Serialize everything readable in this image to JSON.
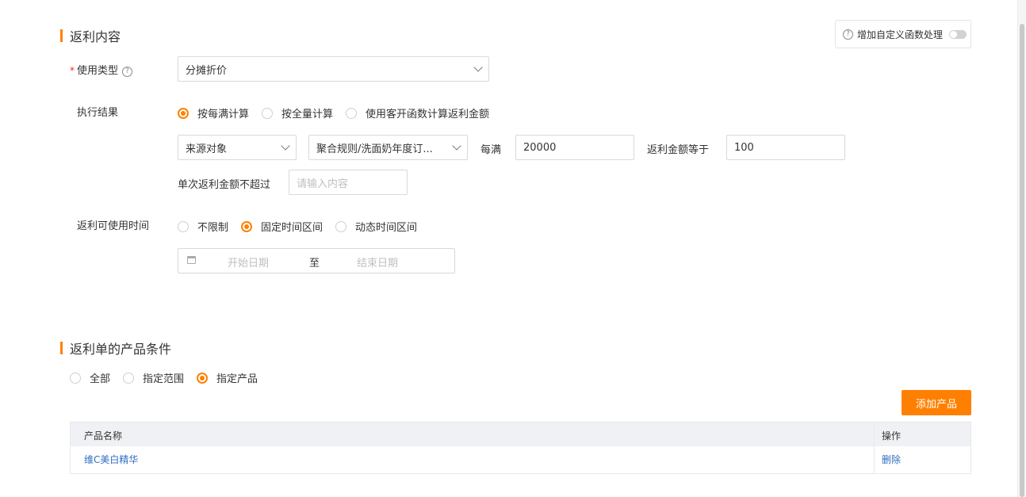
{
  "rebate_content": {
    "title": "返利内容",
    "custom_function": {
      "label": "增加自定义函数处理",
      "enabled": false
    },
    "usage_type": {
      "label": "使用类型",
      "required_mark": "*",
      "value": "分摊折价"
    },
    "execution_result": {
      "label": "执行结果",
      "options": [
        "按每满计算",
        "按全量计算",
        "使用客开函数计算返利金额"
      ],
      "selected": 0
    },
    "rule_row": {
      "source_select": "来源对象",
      "rule_select": "聚合规则/洗面奶年度订...",
      "every_label": "每满",
      "every_value": "20000",
      "equals_label": "返利金额等于",
      "equals_value": "100"
    },
    "max_amount": {
      "label": "单次返利金额不超过",
      "placeholder": "请输入内容"
    },
    "usage_time": {
      "label": "返利可使用时间",
      "options": [
        "不限制",
        "固定时间区间",
        "动态时间区间"
      ],
      "selected": 1,
      "start_placeholder": "开始日期",
      "separator": "至",
      "end_placeholder": "结束日期"
    }
  },
  "product_conditions": {
    "title": "返利单的产品条件",
    "options": [
      "全部",
      "指定范围",
      "指定产品"
    ],
    "selected": 2,
    "add_button": "添加产品",
    "table": {
      "columns": [
        "产品名称",
        "操作"
      ],
      "rows": [
        {
          "name": "维C美白精华",
          "action": "删除"
        }
      ]
    }
  },
  "colors": {
    "accent": "#ff8000",
    "link": "#2f6dc2",
    "header_bg": "#f0f1f4"
  }
}
